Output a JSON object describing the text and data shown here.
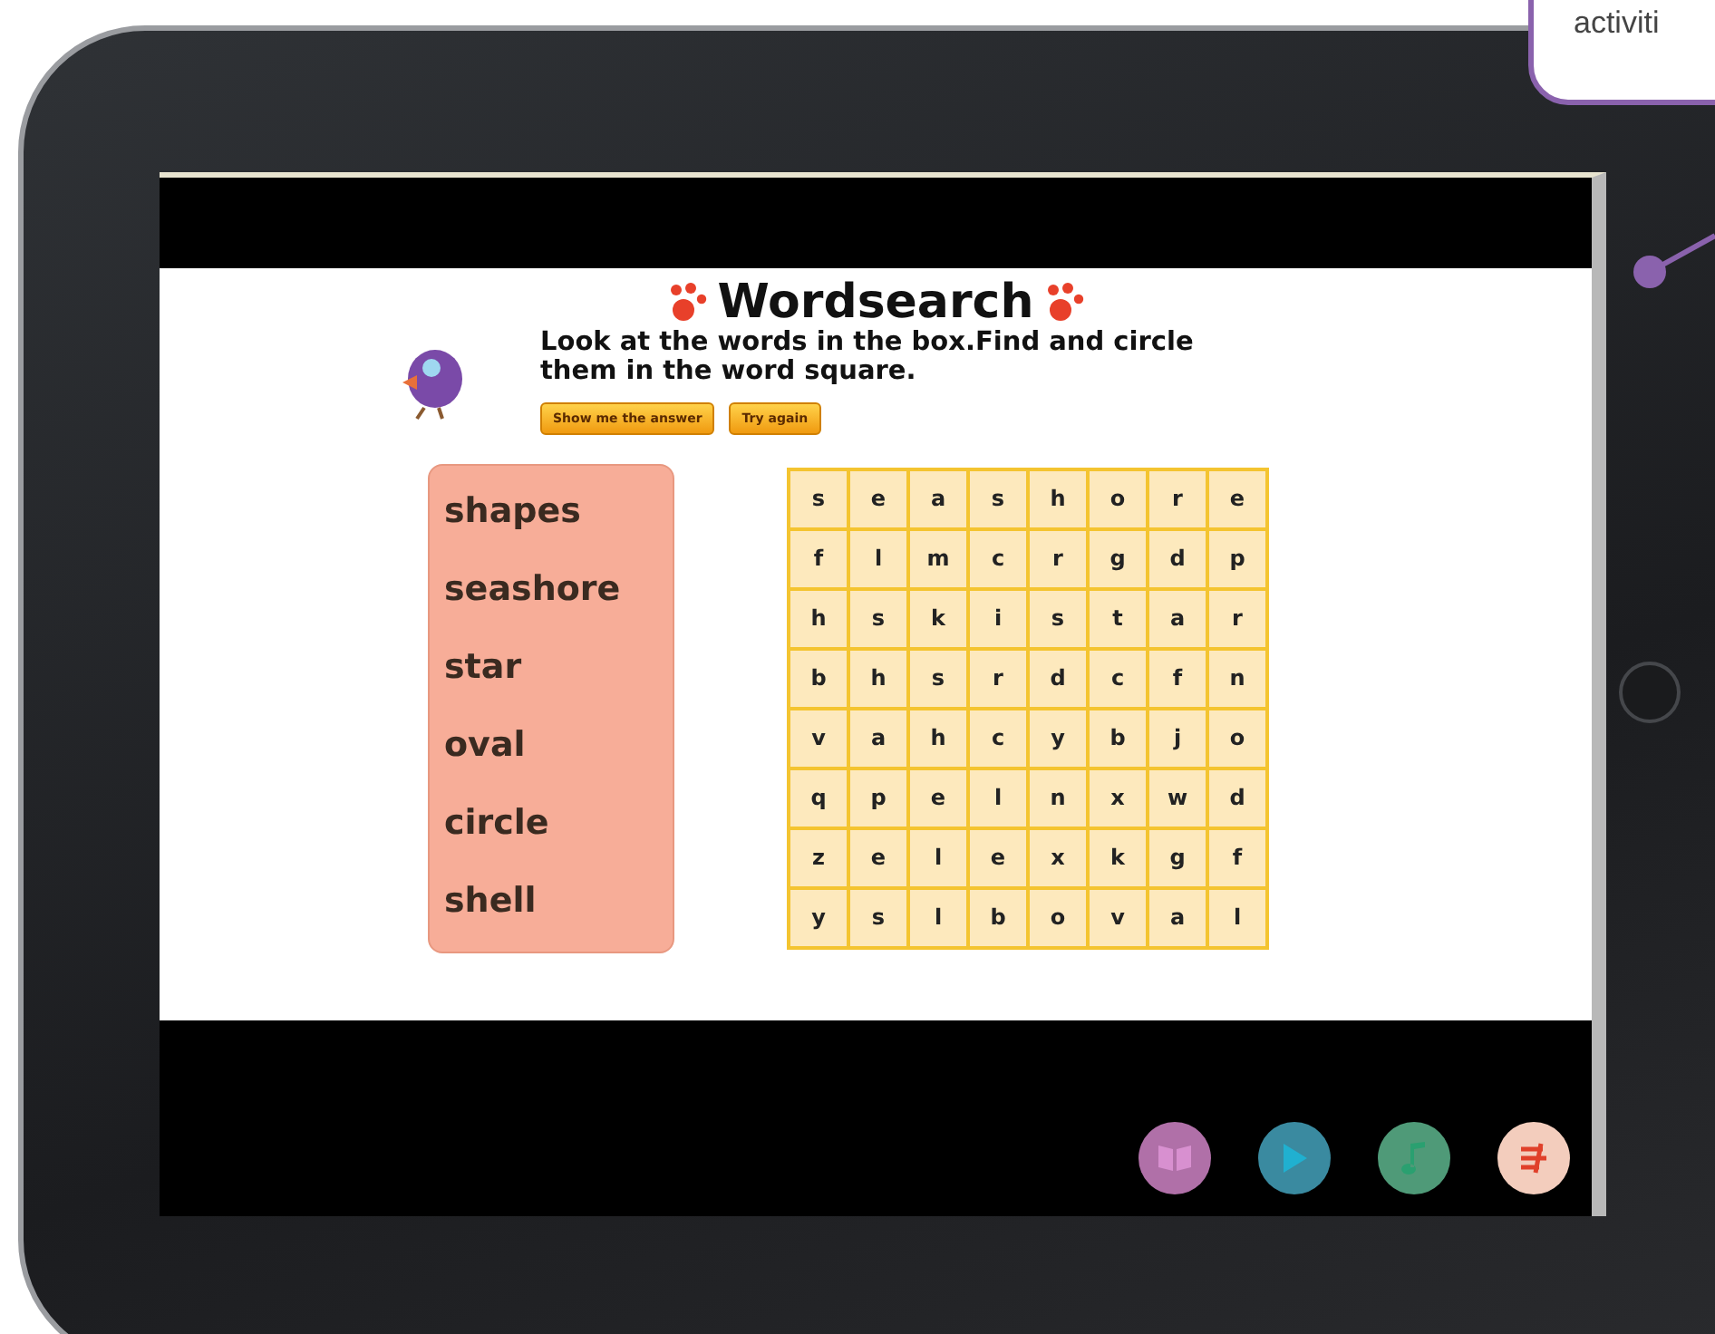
{
  "callout": {
    "text": "activiti"
  },
  "activity": {
    "title": "Wordsearch",
    "instruction": "Look at the words in the box.Find and circle them in the word square.",
    "buttons": [
      "Show me the answer",
      "Try again"
    ],
    "word_list": [
      "shapes",
      "seashore",
      "star",
      "oval",
      "circle",
      "shell"
    ],
    "grid": [
      [
        "s",
        "e",
        "a",
        "s",
        "h",
        "o",
        "r",
        "e"
      ],
      [
        "f",
        "l",
        "m",
        "c",
        "r",
        "g",
        "d",
        "p"
      ],
      [
        "h",
        "s",
        "k",
        "i",
        "s",
        "t",
        "a",
        "r"
      ],
      [
        "b",
        "h",
        "s",
        "r",
        "d",
        "c",
        "f",
        "n"
      ],
      [
        "v",
        "a",
        "h",
        "c",
        "y",
        "b",
        "j",
        "o"
      ],
      [
        "q",
        "p",
        "e",
        "l",
        "n",
        "x",
        "w",
        "d"
      ],
      [
        "z",
        "e",
        "l",
        "e",
        "x",
        "k",
        "g",
        "f"
      ],
      [
        "y",
        "s",
        "l",
        "b",
        "o",
        "v",
        "a",
        "l"
      ]
    ]
  },
  "toolbar": {
    "buttons": [
      {
        "kind": "book",
        "color": "#b070a8"
      },
      {
        "kind": "play",
        "color": "#3a8aa0"
      },
      {
        "kind": "note",
        "color": "#4f9a78"
      },
      {
        "kind": "exit",
        "color": "#f3cdbd"
      }
    ]
  }
}
